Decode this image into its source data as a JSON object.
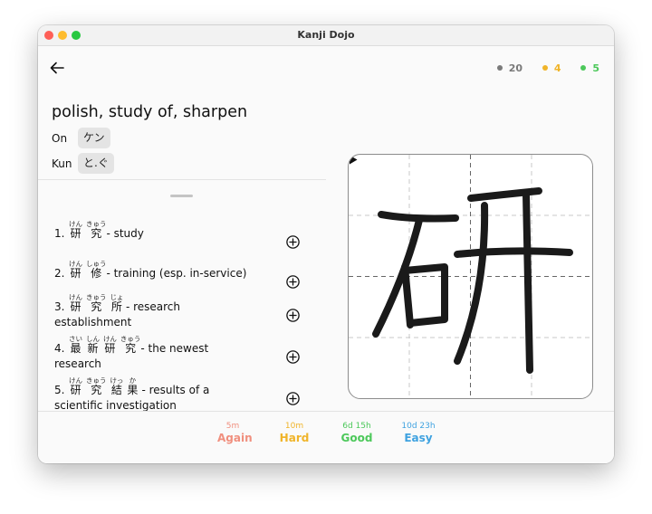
{
  "window": {
    "title": "Kanji Dojo"
  },
  "header": {
    "counts": [
      {
        "value": "20",
        "color": "#7a7a7a"
      },
      {
        "value": "4",
        "color": "#f0b429"
      },
      {
        "value": "5",
        "color": "#4cc85a"
      }
    ]
  },
  "kanji": {
    "character": "研",
    "meaning": "polish, study of, sharpen",
    "on_label": "On",
    "on_reading": "ケン",
    "kun_label": "Kun",
    "kun_reading": "と.ぐ"
  },
  "vocab": [
    {
      "num": "1.",
      "chars": [
        {
          "k": "研",
          "r": "けん"
        },
        {
          "k": "究",
          "r": "きゅう"
        }
      ],
      "meaning": "- study",
      "meaning2": ""
    },
    {
      "num": "2.",
      "chars": [
        {
          "k": "研",
          "r": "けん"
        },
        {
          "k": "修",
          "r": "しゅう"
        }
      ],
      "meaning": "- training (esp. in-service)",
      "meaning2": ""
    },
    {
      "num": "3.",
      "chars": [
        {
          "k": "研",
          "r": "けん"
        },
        {
          "k": "究",
          "r": "きゅう"
        },
        {
          "k": "所",
          "r": "じょ"
        }
      ],
      "meaning": "- research",
      "meaning2": "establishment"
    },
    {
      "num": "4.",
      "chars": [
        {
          "k": "最",
          "r": "さい"
        },
        {
          "k": "新",
          "r": "しん"
        },
        {
          "k": "研",
          "r": "けん"
        },
        {
          "k": "究",
          "r": "きゅう"
        }
      ],
      "meaning": "- the newest",
      "meaning2": "research"
    },
    {
      "num": "5.",
      "chars": [
        {
          "k": "研",
          "r": "けん"
        },
        {
          "k": "究",
          "r": "きゅう"
        },
        {
          "k": "結",
          "r": "けっ"
        },
        {
          "k": "果",
          "r": "か"
        }
      ],
      "meaning": "- results of a",
      "meaning2": "scientific investigation"
    }
  ],
  "grades": [
    {
      "interval": "5m",
      "label": "Again",
      "color": "#f08f7e"
    },
    {
      "interval": "10m",
      "label": "Hard",
      "color": "#f0b429"
    },
    {
      "interval": "6d 15h",
      "label": "Good",
      "color": "#4cc85a"
    },
    {
      "interval": "10d 23h",
      "label": "Easy",
      "color": "#3fa2e0"
    }
  ]
}
